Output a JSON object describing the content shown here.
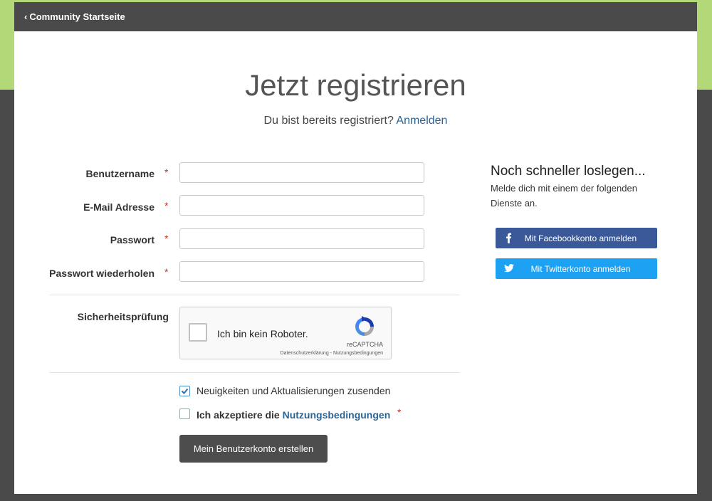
{
  "nav": {
    "back_label": "Community Startseite"
  },
  "page": {
    "title": "Jetzt registrieren",
    "subtitle_text": "Du bist bereits registriert?",
    "login_link": "Anmelden"
  },
  "form": {
    "required_mark": "*",
    "fields": [
      {
        "label": "Benutzername",
        "value": "",
        "placeholder": ""
      },
      {
        "label": "E-Mail Adresse",
        "value": "",
        "placeholder": ""
      },
      {
        "label": "Passwort",
        "value": "",
        "placeholder": ""
      },
      {
        "label": "Passwort wiederholen",
        "value": "",
        "placeholder": ""
      }
    ],
    "security_label": "Sicherheitsprüfung",
    "recaptcha": {
      "label": "Ich bin kein Roboter.",
      "brand": "reCAPTCHA",
      "links": "Datenschutzerklärung - Nutzungsbedingungen",
      "checked": false
    },
    "newsletter": {
      "label": "Neuigkeiten und Aktualisierungen zusenden",
      "checked": true
    },
    "terms": {
      "label_prefix": "Ich akzeptiere die",
      "link": "Nutzungsbedingungen",
      "checked": false
    },
    "submit_label": "Mein Benutzerkonto erstellen"
  },
  "social": {
    "title": "Noch schneller loslegen...",
    "description": "Melde dich mit einem der folgenden Dienste an.",
    "facebook_label": "Mit Facebookkonto anmelden",
    "twitter_label": "Mit Twitterkonto anmelden"
  },
  "colors": {
    "header_bg": "#4a4a4a",
    "accent_green": "#b2d877",
    "link_blue": "#2a6496",
    "facebook": "#3b5998",
    "twitter": "#1da1f2",
    "required": "#c0392b"
  }
}
